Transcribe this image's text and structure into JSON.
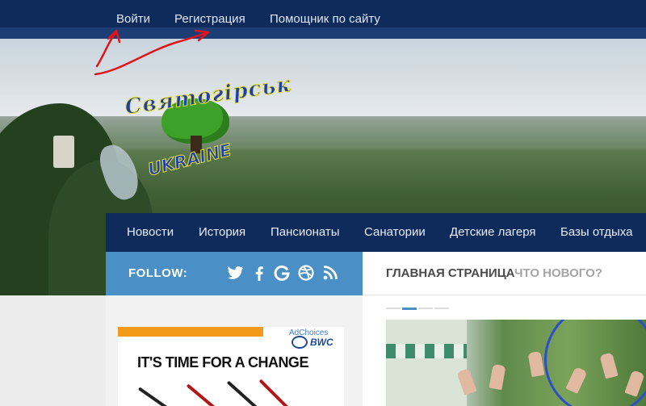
{
  "topbar": {
    "login": "Войти",
    "register": "Регистрация",
    "helper": "Помощник по сайту"
  },
  "logo": {
    "title": "Святогірськ",
    "subtitle": "UKRAINE"
  },
  "mainnav": {
    "items": [
      "Новости",
      "История",
      "Пансионаты",
      "Санатории",
      "Детские лагеря",
      "Базы отдыха"
    ]
  },
  "follow": {
    "label": "FOLLOW:",
    "icons": [
      "twitter-icon",
      "facebook-icon",
      "google-icon",
      "dribbble-icon",
      "rss-icon"
    ]
  },
  "heading": {
    "primary": "ГЛАВНАЯ СТРАНИЦА",
    "secondary": "ЧТО НОВОГО?"
  },
  "ad": {
    "adchoices": "AdChoices",
    "brand": "BWC",
    "headline": "IT'S TIME FOR A CHANGE"
  },
  "colors": {
    "navy": "#0f2b5b",
    "follow_blue": "#4a90c6",
    "annotation_red": "#e0141b"
  }
}
